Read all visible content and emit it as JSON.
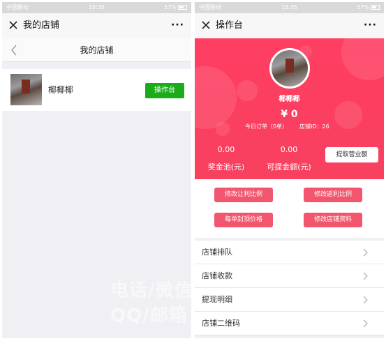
{
  "status_bar": {
    "carrier": "中国移动",
    "time": "15:35",
    "battery": "57%"
  },
  "left": {
    "window_title": "我的店铺",
    "more_label": "···",
    "nav_title": "我的店铺",
    "shop": {
      "name": "椰椰椰",
      "op_button": "操作台"
    }
  },
  "right": {
    "window_title": "操作台",
    "more_label": "···",
    "profile": {
      "name": "椰椰椰",
      "amount": "¥ 0",
      "today_orders": "今日订单（0单）",
      "shop_id": "店铺ID：26"
    },
    "stats": [
      {
        "value": "0.00",
        "label": "奖金池(元)"
      },
      {
        "value": "0.00",
        "label": "可提金额(元)"
      }
    ],
    "withdraw_button": "提取营业额",
    "action_buttons": [
      "修改让利比例",
      "修改返利比例",
      "每单封顶价格",
      "修改店铺资料"
    ],
    "menu": [
      "店铺排队",
      "店铺收款",
      "提现明细",
      "店铺二维码"
    ]
  },
  "watermark": {
    "line1": "电话/微信",
    "line2": "QQ/邮箱"
  },
  "colors": {
    "hero_red": "#f8405f",
    "button_pink": "#f2566e",
    "wechat_green": "#1aad19"
  }
}
